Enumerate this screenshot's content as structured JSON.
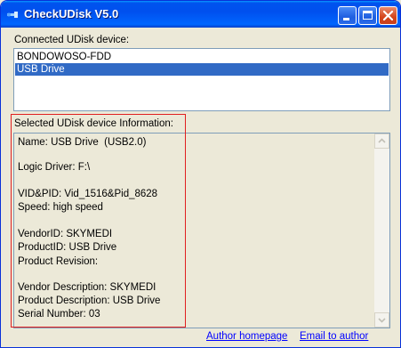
{
  "window": {
    "title": "CheckUDisk V5.0",
    "controls": [
      "minimize",
      "maximize",
      "close"
    ]
  },
  "connected": {
    "label": "Connected UDisk device:",
    "devices": [
      "BONDOWOSO-FDD",
      "USB Drive"
    ],
    "selected_index": 1
  },
  "info": {
    "label": "Selected UDisk device Information:",
    "lines": [
      "Name: USB Drive  (USB2.0)",
      "",
      "Logic Driver: F:\\",
      "",
      "VID&PID: Vid_1516&Pid_8628",
      "Speed: high speed",
      "",
      "VendorID: SKYMEDI",
      "ProductID: USB Drive",
      "Product Revision:",
      "",
      "Vendor Description: SKYMEDI",
      "Product Description: USB Drive",
      "Serial Number: 03"
    ]
  },
  "links": {
    "author_homepage": "Author homepage",
    "email_author": "Email to author"
  },
  "colors": {
    "title_bar": "#0053ee",
    "selection": "#316ac5",
    "highlight_box": "#e02020",
    "link": "#0000ff"
  }
}
